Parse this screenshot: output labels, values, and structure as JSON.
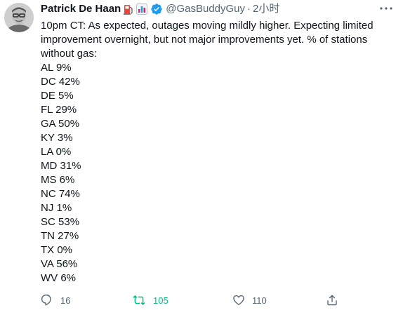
{
  "author": {
    "display_name": "Patrick De Haan",
    "handle": "@GasBuddyGuy",
    "separator": "·",
    "time": "2小时"
  },
  "tweet": {
    "intro": "10pm CT: As expected, outages moving mildly higher. Expecting limited improvement overnight, but not major improvements yet. % of stations without gas:",
    "lines": [
      "AL 9%",
      "DC 42%",
      "DE 5%",
      "FL 29%",
      "GA 50%",
      "KY 3%",
      "LA 0%",
      "MD 31%",
      "MS 6%",
      "NC 74%",
      "NJ 1%",
      "SC 53%",
      "TN 27%",
      "TX 0%",
      "VA 56%",
      "WV 6%"
    ]
  },
  "actions": {
    "reply_count": "16",
    "retweet_count": "105",
    "like_count": "110"
  },
  "colors": {
    "text": "#0f1419",
    "muted": "#536471",
    "verified": "#1d9bf0",
    "retweet_active": "#00ba7c"
  },
  "icons": [
    "fuel-pump-icon",
    "bar-chart-icon",
    "verified-badge-icon",
    "more-icon",
    "reply-icon",
    "retweet-icon",
    "like-icon",
    "share-icon"
  ]
}
